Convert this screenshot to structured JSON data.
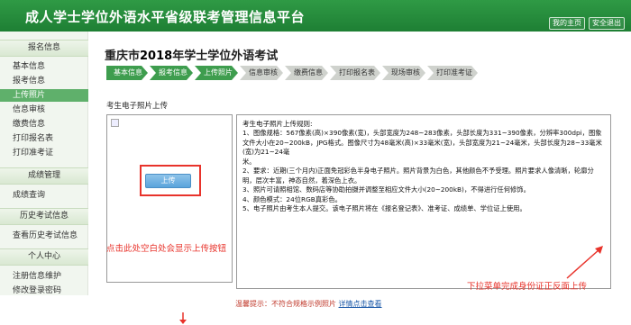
{
  "header": {
    "title": "成人学士学位外语水平省级联考管理信息平台",
    "buttons": [
      "我的主页",
      "安全退出"
    ]
  },
  "sidebar": {
    "sections": [
      {
        "title": "报名信息",
        "items": [
          "基本信息",
          "报考信息",
          "上传照片",
          "信息审核",
          "缴费信息",
          "打印报名表",
          "打印准考证"
        ]
      },
      {
        "title": "成绩管理",
        "items": [
          "成绩查询"
        ]
      },
      {
        "title": "历史考试信息",
        "items": [
          "查看历史考试信息"
        ]
      },
      {
        "title": "个人中心",
        "items": [
          "注册信息维护",
          "修改登录密码"
        ]
      }
    ],
    "active_item": "上传照片"
  },
  "main": {
    "title_prefix": "重庆市",
    "title_year": "2018",
    "title_suffix": "年学士学位外语考试",
    "steps": [
      "基本信息",
      "报考信息",
      "上传照片",
      "信息审核",
      "缴费信息",
      "打印报名表",
      "现场审核",
      "打印准考证"
    ],
    "completed_steps": 3,
    "photo_section_label": "考生电子照片上传",
    "upload_button": "上传",
    "rules_title": "考生电子照片上传规则:",
    "rules": [
      "1、图像规格：567像素(高)×390像素(宽)，头部宽度为248~283像素，头部长度为331~390像素，分辨率300dpi，图象",
      "文件大小在20~200kB，JPG格式。图像尺寸为48毫米(高)×33毫米(宽)，头部宽度为21~24毫米，头部长度为28~33毫米(宽)为21~24毫",
      "米。",
      "2、要求：近期(三个月内)正面免冠彩色半身电子照片。照片背景为白色，其他颜色不予受理。照片要求人像清晰，轮廓分",
      "明，层次丰富，神态自然，着深色上衣。",
      "3、照片可请照相馆、数码店等协助拍摄并调整至相应文件大小(20~200kB)，不得进行任何修饰。",
      "4、颜色模式：24位RGB真彩色。",
      "5、电子照片由考生本人提交。该电子照片将在《报名登记表》、准考证、成绩单、学位证上使用。"
    ],
    "annotation_left": "点击此处空白处会显示上传按钮",
    "annotation_right": "下拉菜单完成身份证正反面上传",
    "warning_prefix": "温馨提示：不符合规格示例照片",
    "warning_link": "详情点击查看"
  }
}
